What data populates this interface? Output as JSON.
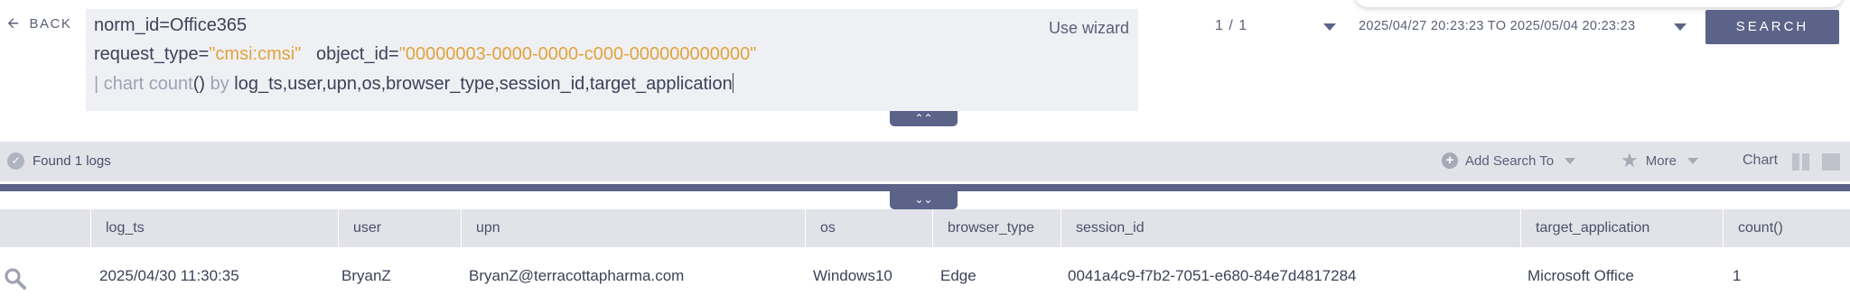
{
  "nav": {
    "back_label": "BACK"
  },
  "query": {
    "line1": "norm_id=Office365",
    "line2_k1": "request_type=",
    "line2_v1": "\"cmsi:cmsi\"",
    "line2_k2": "object_id=",
    "line2_v2": "\"00000003-0000-0000-c000-000000000000\"",
    "line3_pipe": "| chart count",
    "line3_paren": "()",
    "line3_by": " by ",
    "line3_fields": "log_ts,user,upn,os,browser_type,session_id,target_application",
    "use_wizard_label": "Use wizard"
  },
  "pagination": {
    "text": "1 / 1"
  },
  "time_range": {
    "text": "2025/04/27 20:23:23 TO 2025/05/04 20:23:23"
  },
  "search_button_label": "SEARCH",
  "status": {
    "found_text": "Found 1 logs",
    "add_search_to_label": "Add Search To",
    "more_label": "More",
    "chart_label": "Chart"
  },
  "table": {
    "columns": [
      "log_ts",
      "user",
      "upn",
      "os",
      "browser_type",
      "session_id",
      "target_application",
      "count()"
    ],
    "rows": [
      [
        "2025/04/30 11:30:35",
        "BryanZ",
        "BryanZ@terracottapharma.com",
        "Windows10",
        "Edge",
        "0041a4c9-f7b2-7051-e680-84e7d4817284",
        "Microsoft Office",
        "1"
      ]
    ]
  },
  "icons": {
    "back": "back-arrow-icon",
    "collapse_up": "double-chevron-up-icon",
    "collapse_down": "double-chevron-down-icon",
    "found": "check-circle-icon",
    "add_search": "plus-circle-icon",
    "more": "star-icon",
    "row_search": "magnifier-icon"
  },
  "colors": {
    "accent": "#5c6388",
    "query_string": "#e0a33c",
    "query_keyword": "#9ea2b3",
    "panel_bg": "#eff0f4",
    "bar_bg": "#e2e3e9"
  }
}
